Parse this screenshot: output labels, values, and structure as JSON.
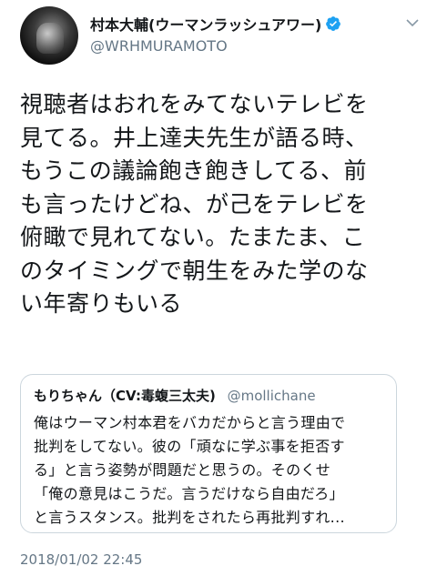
{
  "author": {
    "display_name": "村本大輔(ウーマンラッシュアワー)",
    "handle": "@WRHMURAMOTO",
    "verified_icon": "verified-badge-icon",
    "menu_icon": "chevron-down-icon"
  },
  "tweet": {
    "lines": [
      "視聴者はおれをみてないテレビを",
      "見てる。井上達夫先生が語る時、",
      "もうこの議論飽き飽きしてる、前",
      "も言ったけどね、が己をテレビを",
      "俯瞰で見れてない。たまたま、こ",
      "のタイミングで朝生をみた学のな",
      "い年寄りもいる"
    ],
    "timestamp": "2018/01/02 22:45"
  },
  "quote": {
    "name": "もりちゃん（CV:毒蝮三太夫)",
    "handle": "@mollichane",
    "lines": [
      "俺はウーマン村本君をバカだからと言う理由で",
      "批判をしてない。彼の「頑なに学ぶ事を拒否す",
      "る」と言う姿勢が問題だと思うの。そのくせ",
      "「俺の意見はこうだ。言うだけなら自由だろ」",
      "と言うスタンス。批判をされたら再批判すれ..."
    ]
  },
  "colors": {
    "text": "#14171a",
    "secondary": "#657786",
    "verified": "#1da1f2",
    "border": "#ccd6dd"
  }
}
